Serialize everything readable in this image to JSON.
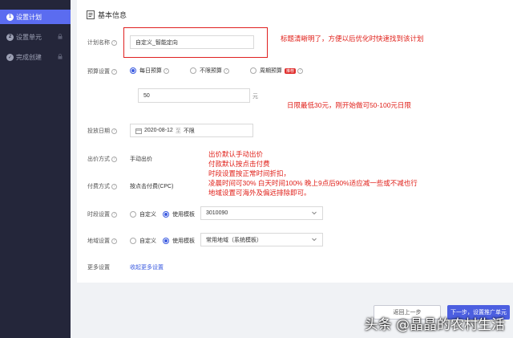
{
  "sidebar": {
    "steps": [
      {
        "num": "1",
        "label": "设置计划"
      },
      {
        "num": "2",
        "label": "设置单元"
      },
      {
        "num": "✓",
        "label": "完成创建"
      }
    ]
  },
  "card": {
    "title": "基本信息"
  },
  "plan_name": {
    "label": "计划名称",
    "value": "自定义_智能定向"
  },
  "budget": {
    "label": "预算设置",
    "options": [
      "每日预算",
      "不限预算",
      "周期预算"
    ],
    "badge": "推荐",
    "value": "50",
    "unit": "元"
  },
  "dates": {
    "label": "投放日期",
    "start": "2020-08-12",
    "sep": "至",
    "end": "不限"
  },
  "bid_method": {
    "label": "出价方式",
    "value": "手动出价"
  },
  "pay_method": {
    "label": "付费方式",
    "value": "按点击付费(CPC)"
  },
  "time_slot": {
    "label": "时段设置",
    "opt1": "自定义",
    "opt2": "使用模板",
    "select": "3010090"
  },
  "region": {
    "label": "地域设置",
    "opt1": "自定义",
    "opt2": "使用模板",
    "select": "常用地域（系统模板）"
  },
  "more": {
    "label": "更多设置",
    "link": "收起更多设置"
  },
  "buttons": {
    "prev": "返回上一步",
    "next": "下一步，设置推广单元"
  },
  "annotations": {
    "a1": "标题清晰明了，方便以后优化时快速找到该计划",
    "a2": "日限最低30元，刚开始做可50-100元日限",
    "a3": [
      "出价默认手动出价",
      "付款默认按点击付费",
      "时段设置按正常时间折扣，",
      "凌晨时间可30% 白天时间100% 晚上9点后90%适应减一些或不减也行",
      "地域设置可海外及偏远排除即可。"
    ]
  },
  "watermark": "头条 @晶晶的农村生活",
  "colors": {
    "sidebar": "#24263a",
    "accent": "#5b6cf0",
    "annotation": "#e0201a"
  }
}
